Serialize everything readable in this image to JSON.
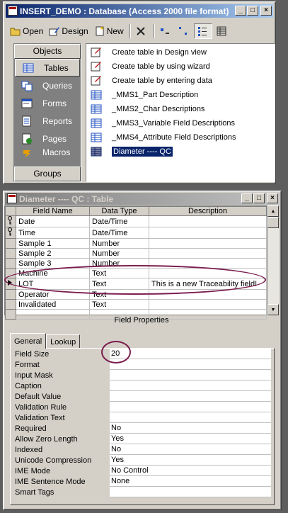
{
  "db_window": {
    "title": "INSERT_DEMO : Database (Access 2000 file format)",
    "toolbar": {
      "open": "Open",
      "design": "Design",
      "new": "New"
    },
    "objects_header": "Objects",
    "objects": [
      {
        "label": "Tables",
        "icon": "table-icon"
      },
      {
        "label": "Queries",
        "icon": "query-icon"
      },
      {
        "label": "Forms",
        "icon": "form-icon"
      },
      {
        "label": "Reports",
        "icon": "report-icon"
      },
      {
        "label": "Pages",
        "icon": "page-icon"
      },
      {
        "label": "Macros",
        "icon": "macro-icon"
      }
    ],
    "groups_label": "Groups",
    "items": [
      "Create table in Design view",
      "Create table by using wizard",
      "Create table by entering data",
      "_MMS1_Part Description",
      "_MMS2_Char Descriptions",
      "_MMS3_Variable Field Descriptions",
      "_MMS4_Attribute Field Descriptions",
      "Diameter ---- QC"
    ]
  },
  "table_window": {
    "title": "Diameter ---- QC : Table",
    "columns": [
      "Field Name",
      "Data Type",
      "Description"
    ],
    "rows": [
      {
        "name": "Date",
        "type": "Date/Time",
        "desc": ""
      },
      {
        "name": "Time",
        "type": "Date/Time",
        "desc": ""
      },
      {
        "name": "Sample 1",
        "type": "Number",
        "desc": ""
      },
      {
        "name": "Sample 2",
        "type": "Number",
        "desc": ""
      },
      {
        "name": "Sample 3",
        "type": "Number",
        "desc": ""
      },
      {
        "name": "Machine",
        "type": "Text",
        "desc": ""
      },
      {
        "name": "LOT",
        "type": "Text",
        "desc": "This is a new Traceability field!"
      },
      {
        "name": "Operator",
        "type": "Text",
        "desc": ""
      },
      {
        "name": "Invalidated",
        "type": "Text",
        "desc": ""
      }
    ],
    "field_properties_label": "Field Properties",
    "tabs": [
      "General",
      "Lookup"
    ],
    "properties": [
      {
        "label": "Field Size",
        "value": "20"
      },
      {
        "label": "Format",
        "value": ""
      },
      {
        "label": "Input Mask",
        "value": ""
      },
      {
        "label": "Caption",
        "value": ""
      },
      {
        "label": "Default Value",
        "value": ""
      },
      {
        "label": "Validation Rule",
        "value": ""
      },
      {
        "label": "Validation Text",
        "value": ""
      },
      {
        "label": "Required",
        "value": "No"
      },
      {
        "label": "Allow Zero Length",
        "value": "Yes"
      },
      {
        "label": "Indexed",
        "value": "No"
      },
      {
        "label": "Unicode Compression",
        "value": "Yes"
      },
      {
        "label": "IME Mode",
        "value": "No Control"
      },
      {
        "label": "IME Sentence Mode",
        "value": "None"
      },
      {
        "label": "Smart Tags",
        "value": ""
      }
    ]
  }
}
